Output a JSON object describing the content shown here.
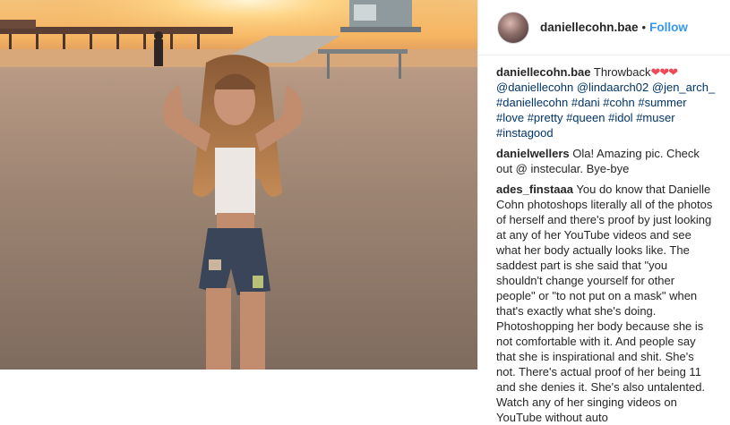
{
  "header": {
    "username": "daniellecohn.bae",
    "separator": "•",
    "follow_label": "Follow"
  },
  "caption": {
    "username": "daniellecohn.bae",
    "text": "Throwback",
    "hearts": "❤❤❤",
    "mentions": [
      "@daniellecohn",
      "@lindaarch02",
      "@jen_arch_"
    ],
    "hashtags": [
      "#daniellecohn",
      "#dani",
      "#cohn",
      "#summer",
      "#love",
      "#pretty",
      "#queen",
      "#idol",
      "#muser",
      "#instagood"
    ]
  },
  "comments": [
    {
      "username": "danielwellers",
      "text": "Ola! Amazing pic. Check out @ instecular. Bye-bye"
    },
    {
      "username": "ades_finstaaa",
      "text": "You do know that Danielle Cohn photoshops literally all of the photos of herself and there's proof by just looking at any of her YouTube videos and see what her body actually looks like. The saddest part is she said that \"you shouldn't change yourself for other people\" or \"to not put on a mask\" when that's exactly what she's doing. Photoshopping her body because she is not comfortable with it. And people say that she is inspirational and shit. She's not. There's actual proof of her being 11 and she denies it. She's also untalented. Watch any of her singing videos on YouTube without auto"
    }
  ],
  "colors": {
    "link": "#003569",
    "follow": "#3897f0",
    "heart": "#ed4956"
  }
}
